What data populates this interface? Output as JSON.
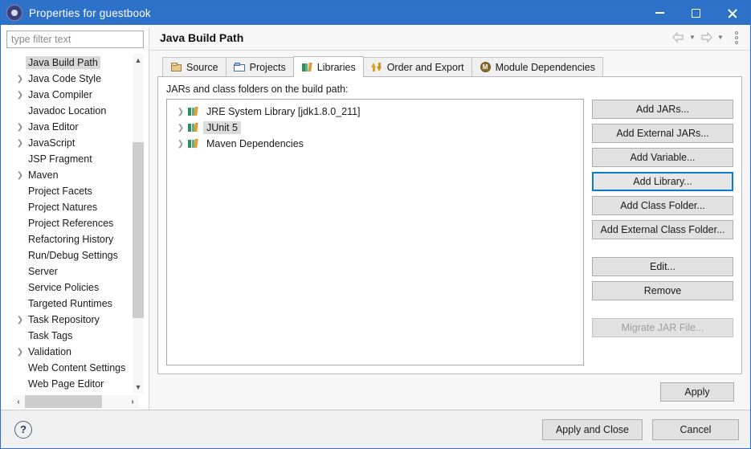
{
  "window": {
    "title": "Properties for guestbook",
    "icon": "gear-icon",
    "minimize_label": "Minimize",
    "maximize_label": "Maximize",
    "close_label": "Close"
  },
  "sidebar": {
    "filter": {
      "placeholder": "type filter text",
      "value": ""
    },
    "items": [
      {
        "label": "Java Build Path",
        "expandable": false,
        "selected": true
      },
      {
        "label": "Java Code Style",
        "expandable": true,
        "selected": false
      },
      {
        "label": "Java Compiler",
        "expandable": true,
        "selected": false
      },
      {
        "label": "Javadoc Location",
        "expandable": false,
        "selected": false
      },
      {
        "label": "Java Editor",
        "expandable": true,
        "selected": false
      },
      {
        "label": "JavaScript",
        "expandable": true,
        "selected": false
      },
      {
        "label": "JSP Fragment",
        "expandable": false,
        "selected": false
      },
      {
        "label": "Maven",
        "expandable": true,
        "selected": false
      },
      {
        "label": "Project Facets",
        "expandable": false,
        "selected": false
      },
      {
        "label": "Project Natures",
        "expandable": false,
        "selected": false
      },
      {
        "label": "Project References",
        "expandable": false,
        "selected": false
      },
      {
        "label": "Refactoring History",
        "expandable": false,
        "selected": false
      },
      {
        "label": "Run/Debug Settings",
        "expandable": false,
        "selected": false
      },
      {
        "label": "Server",
        "expandable": false,
        "selected": false
      },
      {
        "label": "Service Policies",
        "expandable": false,
        "selected": false
      },
      {
        "label": "Targeted Runtimes",
        "expandable": false,
        "selected": false
      },
      {
        "label": "Task Repository",
        "expandable": true,
        "selected": false
      },
      {
        "label": "Task Tags",
        "expandable": false,
        "selected": false
      },
      {
        "label": "Validation",
        "expandable": true,
        "selected": false
      },
      {
        "label": "Web Content Settings",
        "expandable": false,
        "selected": false
      },
      {
        "label": "Web Page Editor",
        "expandable": false,
        "selected": false
      }
    ]
  },
  "header": {
    "title": "Java Build Path",
    "back_icon": "arrow-left-icon",
    "back_dropdown_icon": "chevron-down-icon",
    "forward_icon": "arrow-right-icon",
    "forward_dropdown_icon": "chevron-down-icon",
    "menu_icon": "kebab-menu-icon"
  },
  "tabs": [
    {
      "label": "Source",
      "icon": "package-icon",
      "active": false
    },
    {
      "label": "Projects",
      "icon": "folder-open-icon",
      "active": false
    },
    {
      "label": "Libraries",
      "icon": "library-books-icon",
      "active": true
    },
    {
      "label": "Order and Export",
      "icon": "sort-arrows-icon",
      "active": false
    },
    {
      "label": "Module Dependencies",
      "icon": "module-icon",
      "active": false
    }
  ],
  "main": {
    "section_label": "JARs and class folders on the build path:",
    "entries": [
      {
        "label": "JRE System Library [jdk1.8.0_211]",
        "icon": "library-icon",
        "selected": false
      },
      {
        "label": "JUnit 5",
        "icon": "library-icon",
        "selected": true
      },
      {
        "label": "Maven Dependencies",
        "icon": "library-icon",
        "selected": false
      }
    ],
    "buttons": [
      {
        "label": "Add JARs...",
        "state": "normal"
      },
      {
        "label": "Add External JARs...",
        "state": "normal"
      },
      {
        "label": "Add Variable...",
        "state": "normal"
      },
      {
        "label": "Add Library...",
        "state": "focused"
      },
      {
        "label": "Add Class Folder...",
        "state": "normal"
      },
      {
        "label": "Add External Class Folder...",
        "state": "normal"
      },
      {
        "label": "Edit...",
        "state": "normal",
        "gap_before": true
      },
      {
        "label": "Remove",
        "state": "normal"
      },
      {
        "label": "Migrate JAR File...",
        "state": "disabled",
        "gap_before": true
      }
    ],
    "apply_label": "Apply"
  },
  "footer": {
    "help_icon": "help-question-icon",
    "help_glyph": "?",
    "apply_and_close_label": "Apply and Close",
    "cancel_label": "Cancel"
  },
  "colors": {
    "titlebar": "#2d71c9",
    "focus_border": "#0a7bd0",
    "selection": "#d8d8d8",
    "panel_bg": "#f7f7f7",
    "dialog_border": "#2a6fc9"
  }
}
